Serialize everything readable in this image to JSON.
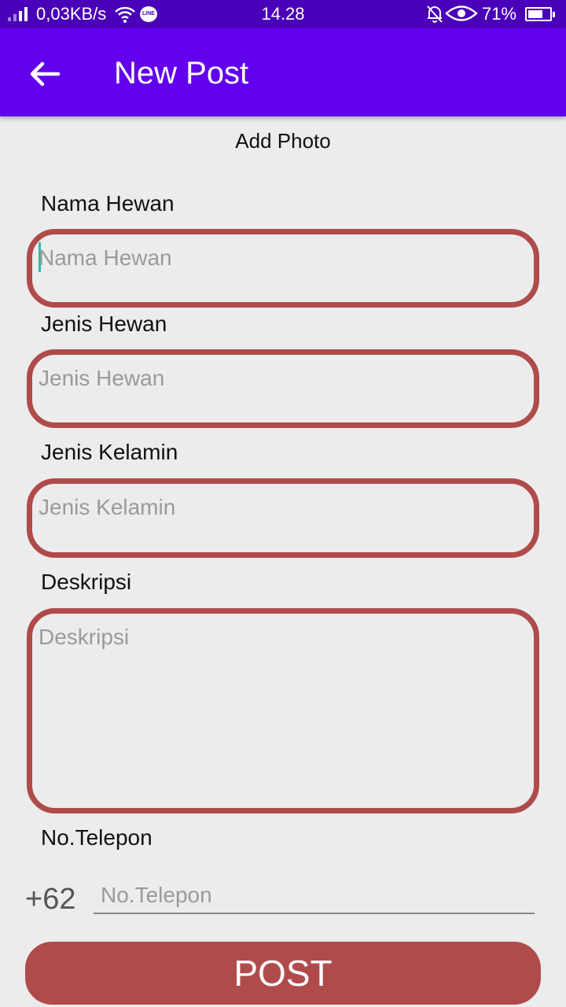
{
  "status_bar": {
    "network_speed": "0,03KB/s",
    "line_badge": "LINE",
    "time": "14.28",
    "battery": "71%",
    "battery_level": 0.71
  },
  "app_bar": {
    "title": "New Post",
    "back_icon": "arrow-left-icon"
  },
  "form": {
    "add_photo": "Add Photo",
    "nama_hewan": {
      "label": "Nama Hewan",
      "placeholder": "Nama Hewan"
    },
    "jenis_hewan": {
      "label": "Jenis Hewan",
      "placeholder": "Jenis Hewan"
    },
    "jenis_kelamin": {
      "label": "Jenis Kelamin",
      "placeholder": "Jenis Kelamin"
    },
    "deskripsi": {
      "label": "Deskripsi",
      "placeholder": "Deskripsi"
    },
    "telepon": {
      "label": "No.Telepon",
      "prefix": "+62",
      "placeholder": "No.Telepon"
    },
    "submit": "POST"
  },
  "colors": {
    "status_bar": "#4a00b8",
    "app_bar": "#6200ee",
    "accent_red": "#b04b4b",
    "background": "#ececec"
  }
}
